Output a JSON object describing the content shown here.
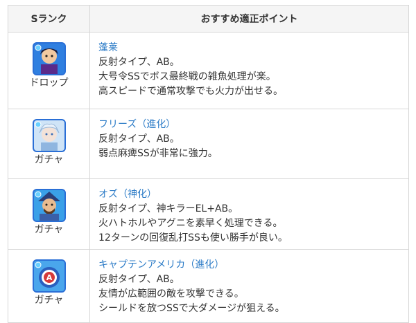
{
  "header": {
    "rank_label": "Sランク",
    "points_label": "おすすめ適正ポイント"
  },
  "rows": [
    {
      "icon": "horai-character-icon",
      "obtain": "ドロップ",
      "name": "蓬莱",
      "lines": [
        "反射タイプ、AB。",
        "大号令SSでボス最終戦の雑魚処理が楽。",
        "高スピードで通常攻撃でも火力が出せる。"
      ]
    },
    {
      "icon": "freeze-character-icon",
      "obtain": "ガチャ",
      "name": "フリーズ（進化）",
      "lines": [
        "反射タイプ、AB。",
        "弱点麻痺SSが非常に強力。"
      ]
    },
    {
      "icon": "oz-character-icon",
      "obtain": "ガチャ",
      "name": "オズ（神化）",
      "lines": [
        "反射タイプ、神キラーEL+AB。",
        "火ハトホルやアグニを素早く処理できる。",
        "12ターンの回復乱打SSも使い勝手が良い。"
      ]
    },
    {
      "icon": "captain-america-character-icon",
      "obtain": "ガチャ",
      "name": "キャプテンアメリカ（進化）",
      "lines": [
        "反射タイプ、AB。",
        "友情が広範囲の敵を攻撃できる。",
        "シールドを放つSSで大ダメージが狙える。"
      ]
    }
  ],
  "colors": {
    "link": "#2d7cc7",
    "header_bg": "#f5f5f5",
    "border": "#d6d6d6"
  }
}
